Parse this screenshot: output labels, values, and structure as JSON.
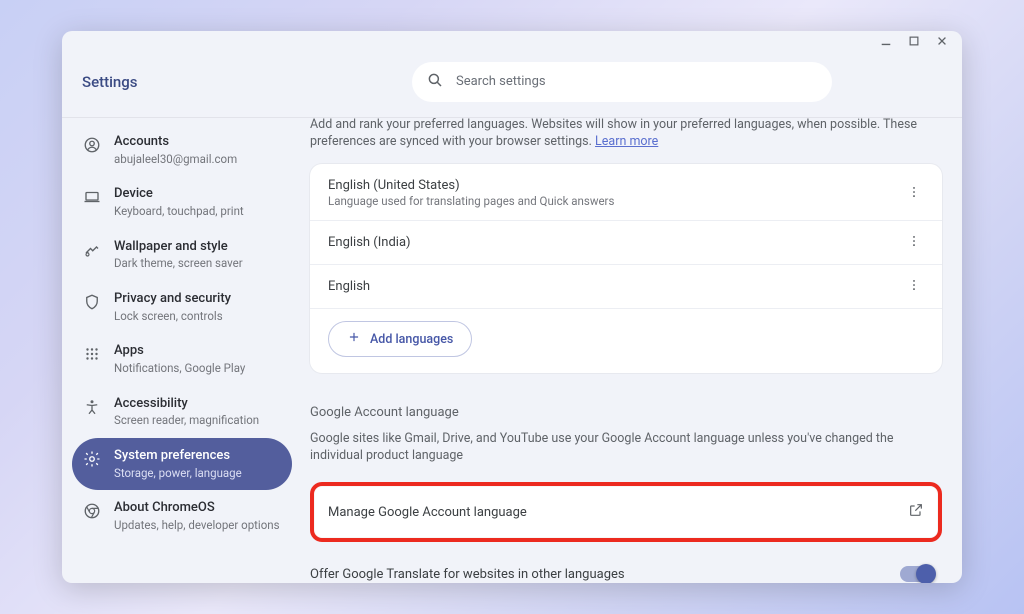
{
  "window": {
    "title": "Settings"
  },
  "search": {
    "placeholder": "Search settings"
  },
  "sidebar": {
    "items": [
      {
        "label": "Accounts",
        "sub": "abujaleel30@gmail.com"
      },
      {
        "label": "Device",
        "sub": "Keyboard, touchpad, print"
      },
      {
        "label": "Wallpaper and style",
        "sub": "Dark theme, screen saver"
      },
      {
        "label": "Privacy and security",
        "sub": "Lock screen, controls"
      },
      {
        "label": "Apps",
        "sub": "Notifications, Google Play"
      },
      {
        "label": "Accessibility",
        "sub": "Screen reader, magnification"
      },
      {
        "label": "System preferences",
        "sub": "Storage, power, language"
      },
      {
        "label": "About ChromeOS",
        "sub": "Updates, help, developer options"
      }
    ]
  },
  "main": {
    "truncated_desc_prefix": "Add and rank your preferred languages. Websites will show in your preferred languages, when possible. These preferences are synced with your browser settings. ",
    "learn_more": "Learn more",
    "languages": [
      {
        "name": "English (United States)",
        "hint": "Language used for translating pages and Quick answers"
      },
      {
        "name": "English (India)",
        "hint": ""
      },
      {
        "name": "English",
        "hint": ""
      }
    ],
    "add_languages_label": "Add languages",
    "google_account_title": "Google Account language",
    "google_account_desc": "Google sites like Gmail, Drive, and YouTube use your Google Account language unless you've changed the individual product language",
    "manage_label": "Manage Google Account language",
    "translate_toggle_label": "Offer Google Translate for websites in other languages",
    "translate_toggle_on": true
  }
}
